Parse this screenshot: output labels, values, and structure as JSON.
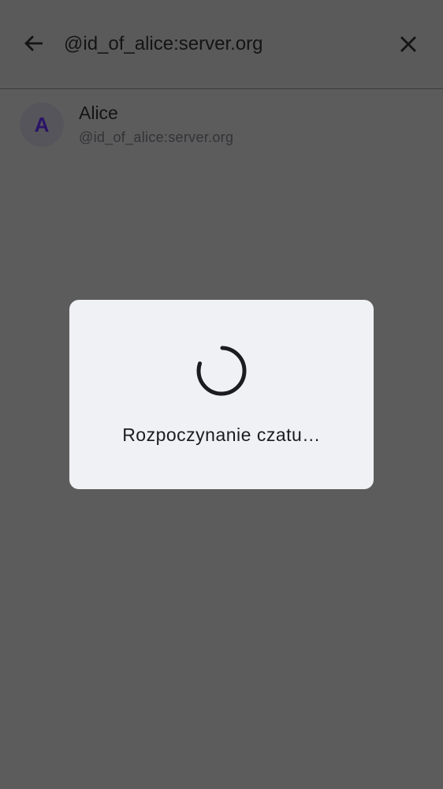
{
  "search": {
    "query": "@id_of_alice:server.org"
  },
  "results": [
    {
      "initial": "A",
      "name": "Alice",
      "user_id": "@id_of_alice:server.org"
    }
  ],
  "dialog": {
    "message": "Rozpoczynanie czatu…"
  }
}
